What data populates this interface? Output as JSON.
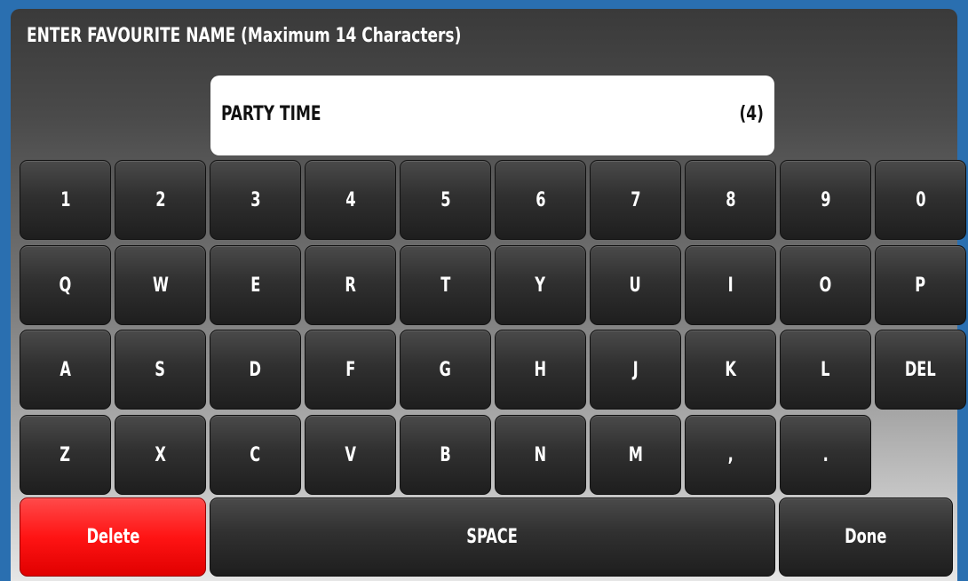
{
  "dialog": {
    "title": "ENTER FAVOURITE NAME (Maximum 14 Characters)",
    "input_value": "PARTY TIME",
    "char_count": "(4)"
  },
  "keyboard": {
    "rows": [
      [
        "1",
        "2",
        "3",
        "4",
        "5",
        "6",
        "7",
        "8",
        "9",
        "0"
      ],
      [
        "Q",
        "W",
        "E",
        "R",
        "T",
        "Y",
        "U",
        "I",
        "O",
        "P"
      ],
      [
        "A",
        "S",
        "D",
        "F",
        "G",
        "H",
        "J",
        "K",
        "L",
        "DEL"
      ],
      [
        "Z",
        "X",
        "C",
        "V",
        "B",
        "N",
        "M",
        ",",
        "."
      ]
    ],
    "delete_label": "Delete",
    "space_label": "SPACE",
    "done_label": "Done"
  },
  "colors": {
    "delete_button": "#ff1414",
    "key": "#303030",
    "panel_top": "#3a3a3a"
  }
}
